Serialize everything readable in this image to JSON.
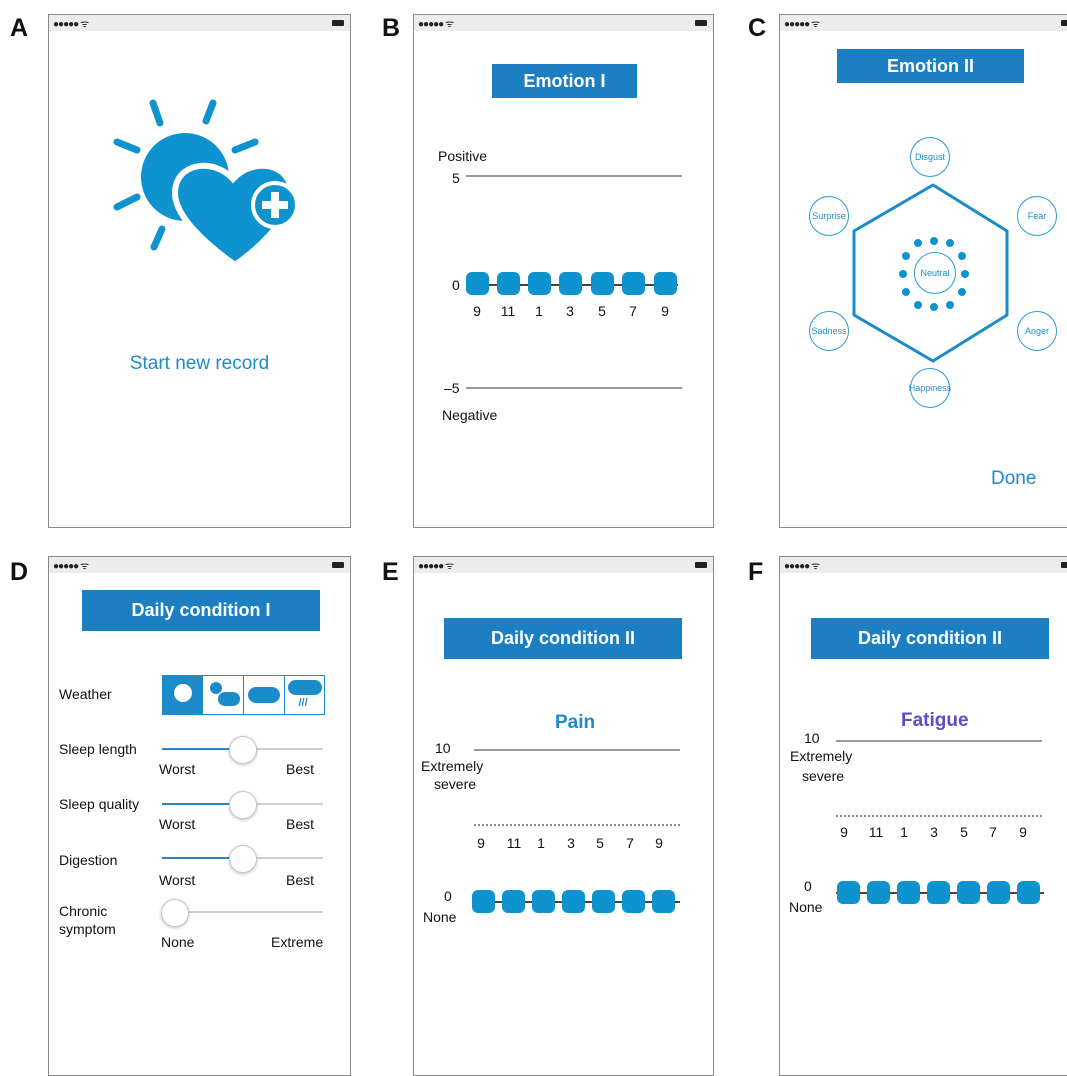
{
  "panels": {
    "a": {
      "label": "A",
      "start_label": "Start new record",
      "icon": "sun-heart-plus-icon"
    },
    "b": {
      "label": "B",
      "title": "Emotion I",
      "positive_label": "Positive",
      "top_value": "5",
      "zero_value": "0",
      "bottom_value": "–5",
      "negative_label": "Negative",
      "hours": [
        "9",
        "11",
        "1",
        "3",
        "5",
        "7",
        "9"
      ]
    },
    "c": {
      "label": "C",
      "title": "Emotion II",
      "emotions": {
        "disgust": "Disgust",
        "fear": "Fear",
        "anger": "Anger",
        "happiness": "Happiness",
        "sadness": "Sadness",
        "surprise": "Surprise",
        "neutral": "Neutral"
      },
      "done_label": "Done"
    },
    "d": {
      "label": "D",
      "title": "Daily condition I",
      "weather_label": "Weather",
      "weather_icons": [
        "sun-icon",
        "partly-cloudy-icon",
        "cloud-icon",
        "rain-icon"
      ],
      "rows": [
        {
          "label": "Sleep length",
          "min": "Worst",
          "max": "Best",
          "value": 0.5
        },
        {
          "label": "Sleep quality",
          "min": "Worst",
          "max": "Best",
          "value": 0.5
        },
        {
          "label": "Digestion",
          "min": "Worst",
          "max": "Best",
          "value": 0.5
        }
      ],
      "chronic_label_1": "Chronic",
      "chronic_label_2": "symptom",
      "chronic_min": "None",
      "chronic_max": "Extreme",
      "chronic_value": 0.08
    },
    "e": {
      "label": "E",
      "title": "Daily condition II",
      "metric": "Pain",
      "top_value": "10",
      "top_label_1": "Extremely",
      "top_label_2": "severe",
      "hours": [
        "9",
        "11",
        "1",
        "3",
        "5",
        "7",
        "9"
      ],
      "bottom_value": "0",
      "bottom_label": "None"
    },
    "f": {
      "label": "F",
      "title": "Daily condition II",
      "metric": "Fatigue",
      "top_value": "10",
      "top_label_1": "Extremely",
      "top_label_2": "severe",
      "hours": [
        "9",
        "11",
        "1",
        "3",
        "5",
        "7",
        "9"
      ],
      "bottom_value": "0",
      "bottom_label": "None"
    }
  },
  "colors": {
    "accent": "#0f93cf",
    "header": "#1b7fc2",
    "fatigue": "#5a4fc8"
  }
}
